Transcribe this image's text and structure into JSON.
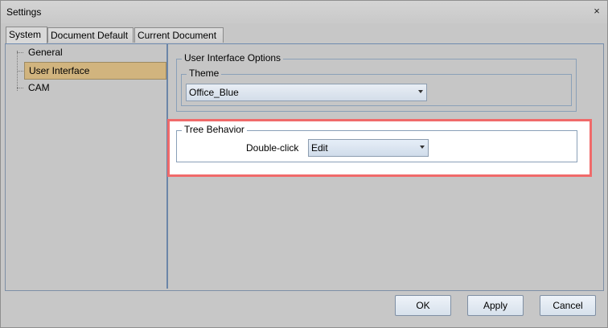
{
  "window": {
    "title": "Settings",
    "close_symbol": "×"
  },
  "tabs": [
    {
      "label": "System"
    },
    {
      "label": "Document Default"
    },
    {
      "label": "Current Document"
    }
  ],
  "tree": {
    "items": [
      {
        "label": "General"
      },
      {
        "label": "User Interface"
      },
      {
        "label": "CAM"
      }
    ]
  },
  "ui_options": {
    "title": "User Interface Options",
    "theme": {
      "title": "Theme",
      "value": "Office_Blue"
    }
  },
  "tree_behavior": {
    "title": "Tree Behavior",
    "double_click_label": "Double-click",
    "double_click_value": "Edit"
  },
  "buttons": {
    "ok": "OK",
    "apply": "Apply",
    "cancel": "Cancel"
  },
  "colors": {
    "selection": "#d1b47e",
    "highlight_border": "#f06a6a",
    "accent_border": "#6b85a8"
  }
}
